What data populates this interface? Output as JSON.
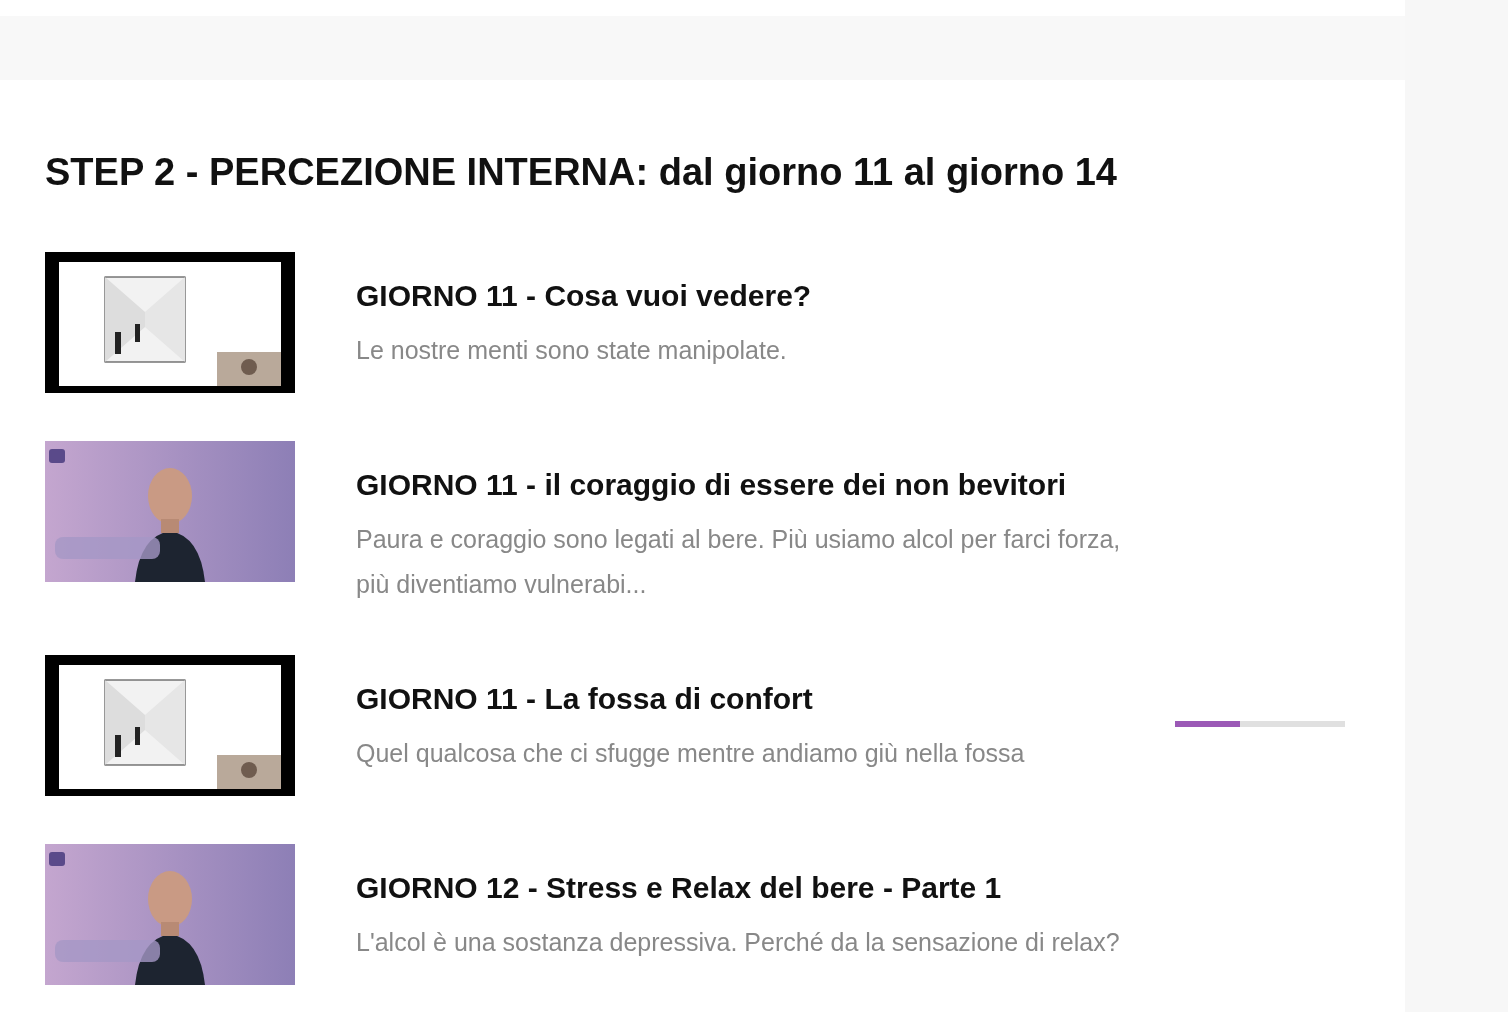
{
  "section": {
    "title": "STEP 2 - PERCEZIONE INTERNA: dal giorno 11 al giorno 14"
  },
  "lessons": [
    {
      "title": "GIORNO 11 - Cosa vuoi vedere?",
      "description": "Le nostre menti sono state manipolate."
    },
    {
      "title": "GIORNO 11 - il coraggio di essere dei non bevitori",
      "description": "Paura e coraggio sono legati al bere.  Più usiamo alcol per farci forza, più diventiamo vulnerabi..."
    },
    {
      "title": "GIORNO 11 - La fossa di confort",
      "description": "Quel qualcosa che ci sfugge mentre andiamo giù nella fossa",
      "level": 0.38
    },
    {
      "title": "GIORNO 12 - Stress e Relax del bere - Parte 1",
      "description": "L'alcol è una sostanza depressiva.  Perché da la sensazione di relax?"
    }
  ]
}
